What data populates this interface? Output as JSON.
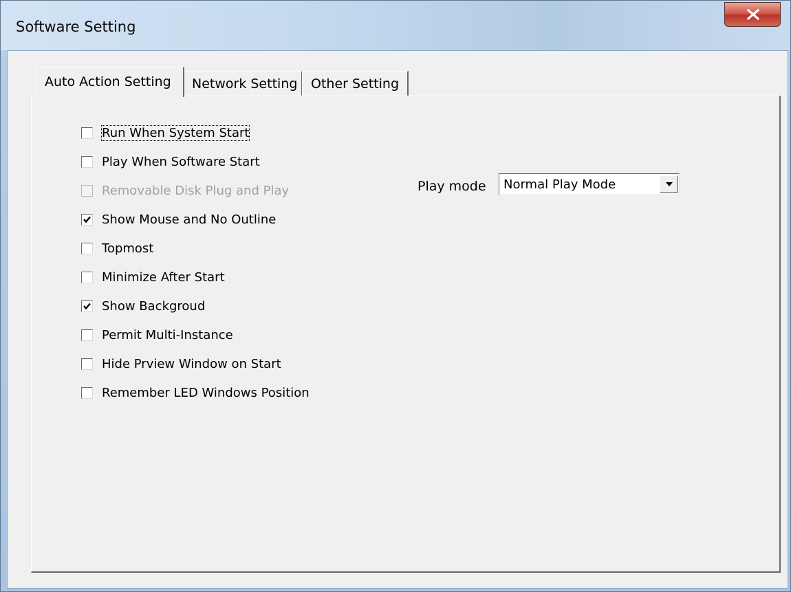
{
  "window": {
    "title": "Software Setting"
  },
  "tabs": [
    {
      "label": "Auto Action Setting",
      "active": true
    },
    {
      "label": "Network Setting",
      "active": false
    },
    {
      "label": "Other Setting",
      "active": false
    }
  ],
  "options": [
    {
      "label": "Run When System Start",
      "checked": false,
      "enabled": true
    },
    {
      "label": "Play When Software Start",
      "checked": false,
      "enabled": true
    },
    {
      "label": "Removable Disk Plug and Play",
      "checked": false,
      "enabled": false
    },
    {
      "label": "Show Mouse and No Outline",
      "checked": true,
      "enabled": true
    },
    {
      "label": "Topmost",
      "checked": false,
      "enabled": true
    },
    {
      "label": "Minimize After Start",
      "checked": false,
      "enabled": true
    },
    {
      "label": "Show Backgroud",
      "checked": true,
      "enabled": true
    },
    {
      "label": "Permit Multi-Instance",
      "checked": false,
      "enabled": true
    },
    {
      "label": "Hide Prview Window on Start",
      "checked": false,
      "enabled": true
    },
    {
      "label": "Remember LED Windows Position",
      "checked": false,
      "enabled": true
    }
  ],
  "play_mode": {
    "label": "Play mode",
    "value": "Normal Play Mode"
  },
  "icons": {
    "close": "close-icon",
    "checkmark": "checkmark-icon",
    "dropdown": "chevron-down-icon"
  }
}
